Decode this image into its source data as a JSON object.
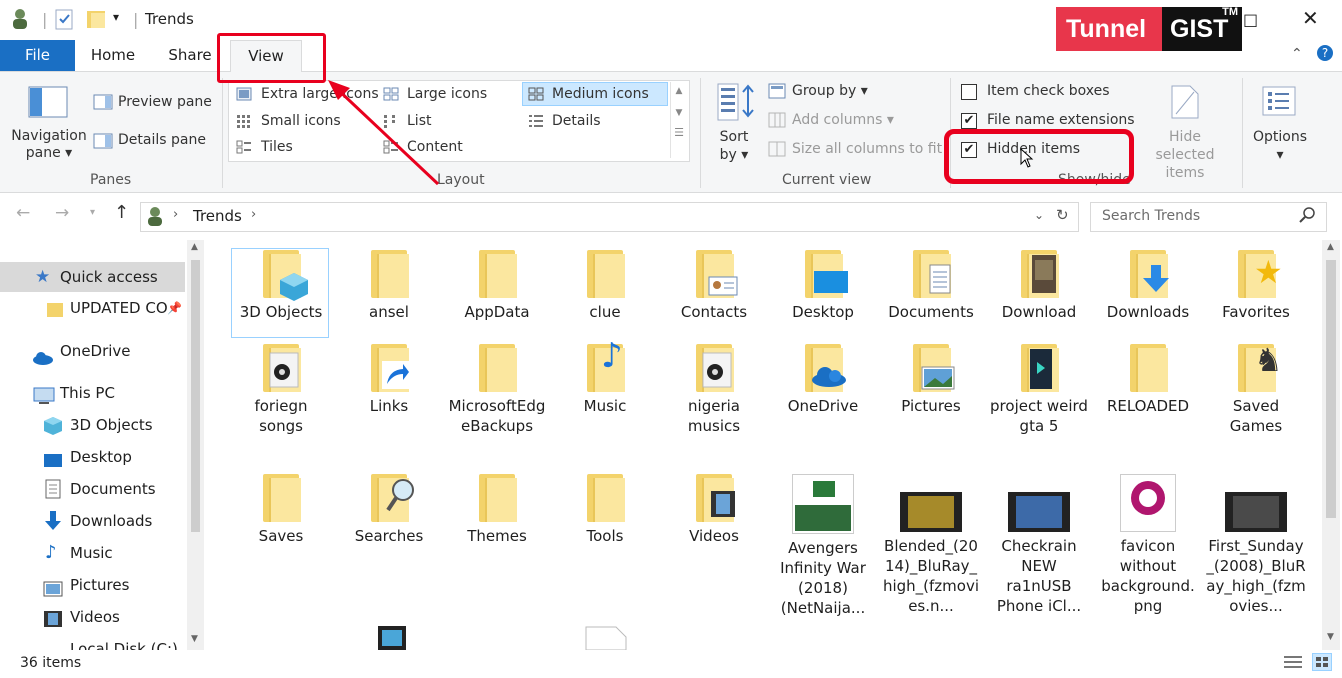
{
  "window": {
    "title": "Trends",
    "controls": {
      "maximize": "□",
      "close": "✕"
    }
  },
  "brand": {
    "part1": "Tunnel",
    "part2": "GIST",
    "tm": "TM"
  },
  "tabs": {
    "file": "File",
    "home": "Home",
    "share": "Share",
    "view": "View"
  },
  "ribbon": {
    "panes": {
      "navigation_pane": "Navigation pane",
      "preview_pane": "Preview pane",
      "details_pane": "Details pane",
      "group_label": "Panes"
    },
    "layout": {
      "extra_large": "Extra large icons",
      "large": "Large icons",
      "medium": "Medium icons",
      "small": "Small icons",
      "list": "List",
      "details": "Details",
      "tiles": "Tiles",
      "content": "Content",
      "group_label": "Layout"
    },
    "current_view": {
      "sort_by": "Sort by",
      "group_by": "Group by",
      "add_columns": "Add columns",
      "size_columns": "Size all columns to fit",
      "group_label": "Current view"
    },
    "show_hide": {
      "item_check_boxes": "Item check boxes",
      "file_name_extensions": "File name extensions",
      "hidden_items": "Hidden items",
      "hide_selected": "Hide selected items",
      "group_label": "Show/hide",
      "item_check_boxes_checked": false,
      "file_name_extensions_checked": true,
      "hidden_items_checked": true
    },
    "options": {
      "label": "Options"
    }
  },
  "address": {
    "breadcrumb": "Trends",
    "search_placeholder": "Search Trends"
  },
  "nav": {
    "quick_access": "Quick access",
    "pinned": "UPDATED CO",
    "onedrive": "OneDrive",
    "this_pc": "This PC",
    "items": [
      "3D Objects",
      "Desktop",
      "Documents",
      "Downloads",
      "Music",
      "Pictures",
      "Videos",
      "Local Disk (C:)"
    ]
  },
  "files": [
    "3D Objects",
    "ansel",
    "AppData",
    "clue",
    "Contacts",
    "Desktop",
    "Documents",
    "Download",
    "Downloads",
    "Favorites",
    "foriegn songs",
    "Links",
    "MicrosoftEdgeBackups",
    "Music",
    "nigeria musics",
    "OneDrive",
    "Pictures",
    "project weird gta 5",
    "RELOADED",
    "Saved Games",
    "Saves",
    "Searches",
    "Themes",
    "Tools",
    "Videos",
    "Avengers Infinity War (2018) (NetNaija...",
    "Blended_(2014)_BluRay_high_(fzmovies.n...",
    "Checkrain NEW ra1nUSB Phone iCl...",
    "favicon without background.png",
    "First_Sunday_(2008)_BluRay_high_(fzmovies..."
  ],
  "status": {
    "count": "36 items"
  },
  "colors": {
    "accent": "#1a6fc4",
    "highlight": "#e8001e",
    "brand_red": "#e8364b"
  }
}
